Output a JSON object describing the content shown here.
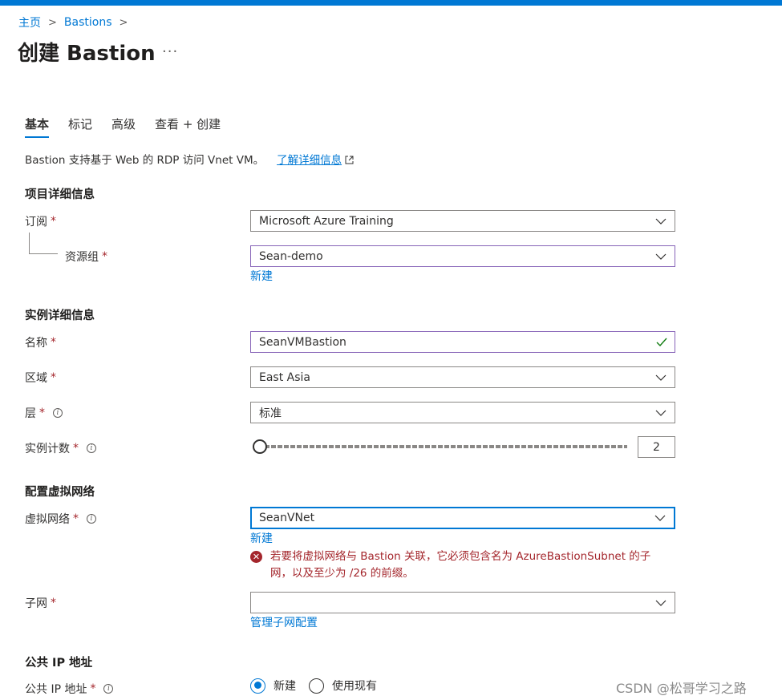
{
  "breadcrumb": {
    "home": "主页",
    "sep": ">",
    "bastions": "Bastions"
  },
  "page": {
    "title": "创建 Bastion",
    "more": "···"
  },
  "tabs": [
    {
      "label": "基本"
    },
    {
      "label": "标记"
    },
    {
      "label": "高级"
    },
    {
      "label": "查看 + 创建"
    }
  ],
  "description": {
    "text": "Bastion 支持基于 Web 的 RDP 访问 Vnet VM。",
    "link": "了解详细信息"
  },
  "project": {
    "section": "项目详细信息",
    "subscription": {
      "label": "订阅",
      "value": "Microsoft Azure Training"
    },
    "resource_group": {
      "label": "资源组",
      "value": "Sean-demo",
      "new_link": "新建"
    }
  },
  "instance": {
    "section": "实例详细信息",
    "name": {
      "label": "名称",
      "value": "SeanVMBastion"
    },
    "region": {
      "label": "区域",
      "value": "East Asia"
    },
    "tier": {
      "label": "层",
      "value": "标准"
    },
    "count": {
      "label": "实例计数",
      "value": "2",
      "slider_fraction": 0
    }
  },
  "vnet": {
    "section": "配置虚拟网络",
    "virtual_network": {
      "label": "虚拟网络",
      "value": "SeanVNet",
      "new_link": "新建"
    },
    "error": {
      "line1": "若要将虚拟网络与 Bastion 关联，它必须包含名为 AzureBastionSubnet 的子",
      "line2": "网，以及至少为 /26 的前缀。"
    },
    "subnet": {
      "label": "子网",
      "value": "",
      "manage_link": "管理子网配置"
    }
  },
  "public_ip": {
    "section": "公共 IP 地址",
    "label": "公共 IP 地址",
    "options": [
      "新建",
      "使用现有"
    ]
  },
  "required_mark": "*",
  "info_glyph": "i",
  "watermark": "CSDN @松哥学习之路",
  "colors": {
    "accent": "#0078d4",
    "error": "#a4262c",
    "purple_border": "#8764b8",
    "success": "#107c10"
  }
}
